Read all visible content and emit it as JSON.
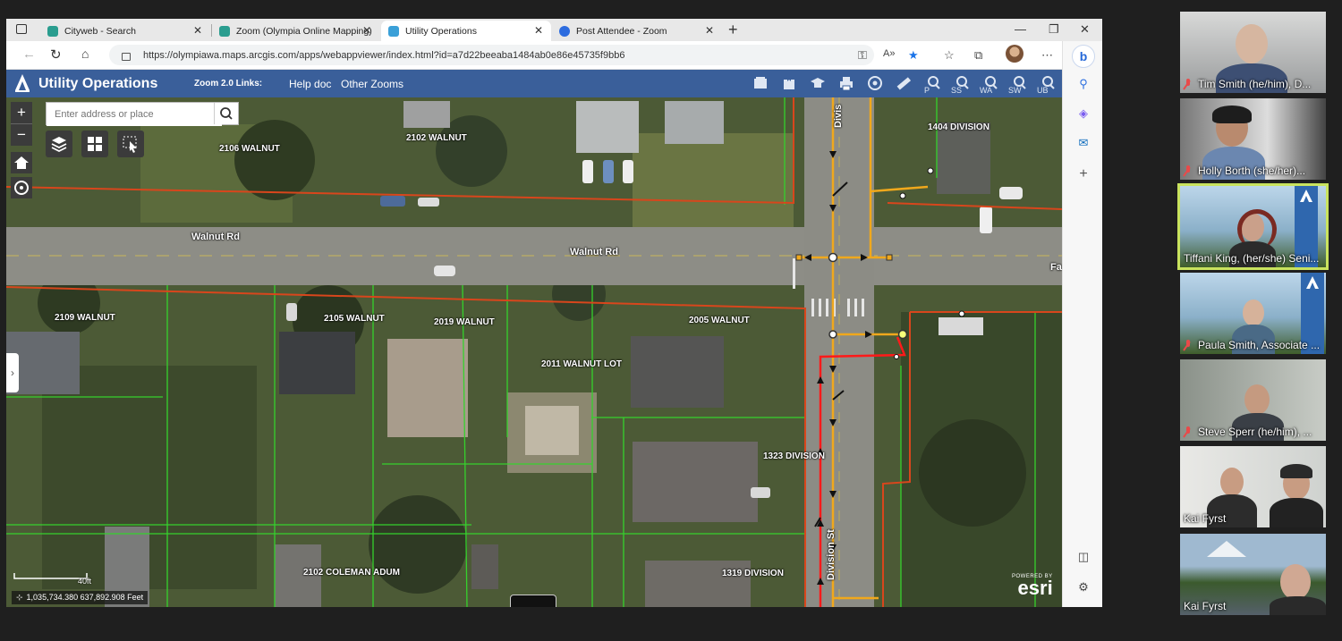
{
  "browser": {
    "tabs": [
      {
        "title": "Cityweb - Search",
        "active": false,
        "fav_color": "#2a9d8f"
      },
      {
        "title": "Zoom (Olympia Online Mapping)",
        "active": false,
        "fav_color": "#2a9d8f"
      },
      {
        "title": "Utility Operations",
        "active": true,
        "fav_color": "#3aa0d8"
      },
      {
        "title": "Post Attendee - Zoom",
        "active": false,
        "fav_color": "#2d6cdf"
      }
    ],
    "url": "https://olympiawa.maps.arcgis.com/apps/webappviewer/index.html?id=a7d22beeaba1484ab0e86e45735f9bb6"
  },
  "app": {
    "title": "Utility Operations",
    "zoom_links_label": "Zoom 2.0 Links:",
    "links": [
      "Help doc",
      "Other Zooms"
    ],
    "widgets": [
      "",
      "",
      "",
      "",
      "",
      "",
      "P",
      "SS",
      "WA",
      "SW",
      "UB"
    ]
  },
  "map": {
    "search_placeholder": "Enter address or place",
    "address_labels": [
      "2106 WALNUT",
      "2102 WALNUT",
      "1404 DIVISION",
      "2109 WALNUT",
      "2105 WALNUT",
      "2019 WALNUT",
      "2005 WALNUT",
      "2011 WALNUT  LOT",
      "1323 DIVISION",
      "2102 COLEMAN  ADUM",
      "1319 DIVISION"
    ],
    "street_labels": [
      "Walnut Rd",
      "Walnut Rd",
      "Divis",
      "Division St",
      "Fa"
    ],
    "scale_label": "40ft",
    "coordinates": "1,035,734.380 637,892.908 Feet",
    "esri_powered": "POWERED BY",
    "esri_brand": "esri"
  },
  "participants": [
    {
      "name": "Tim Smith (he/him), D...",
      "muted": true
    },
    {
      "name": "Holly Borth (she/her)...",
      "muted": true
    },
    {
      "name": "Tiffani King, (her/she) Seni...",
      "muted": false,
      "speaking": true
    },
    {
      "name": "Paula Smith, Associate ...",
      "muted": true
    },
    {
      "name": "Steve Sperr (he/him), ...",
      "muted": true
    },
    {
      "name": "Kai Fyrst",
      "muted": false
    },
    {
      "name": "Kai Fyrst",
      "muted": false
    }
  ]
}
